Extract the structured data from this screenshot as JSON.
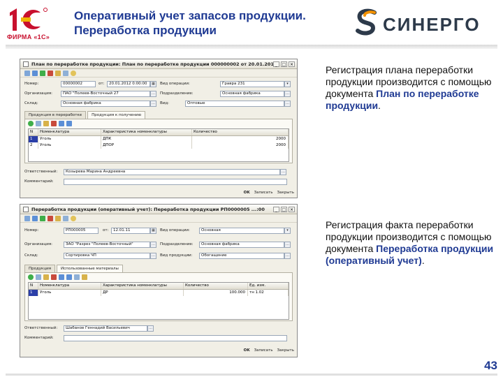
{
  "header": {
    "firm_label": "ФИРМА «1С»",
    "title_line1": "Оперативный учет запасов продукции.",
    "title_line2": "Переработка продукции",
    "partner_name": "СИНЕРГО"
  },
  "window1": {
    "title": "План по переработке продукции: План по переработке продукции 000000002 от 20.01.2012 ...:52",
    "fields": {
      "number_label": "Номер:",
      "number_value": "00000002",
      "date_label": "от:",
      "date_value": "20.01.2012 0:00:00",
      "org_label": "Организация:",
      "org_value": "ПАО \"Полеев-Восточный 27",
      "warehouse_label": "Склад:",
      "warehouse_value": "Основная фабрика",
      "operation_label": "Вид операции:",
      "operation_value": "Гравра 231",
      "unit_label": "Подразделение:",
      "unit_value": "Основная фабрика",
      "type_label": "Вид:",
      "type_value": "Оптовые"
    },
    "tabs": [
      "Продукция в переработке",
      "Продукция к получению"
    ],
    "active_tab": 1,
    "grid_headers": [
      "N",
      "Номенклатура",
      "Характеристика номенклатуры",
      "Количество"
    ],
    "grid_rows": [
      [
        "1",
        "Уголь",
        "ДПК",
        "2000"
      ],
      [
        "2",
        "Уголь",
        "ДПОР",
        "2000"
      ]
    ],
    "responsible_label": "Ответственный:",
    "responsible_value": "Козырева Марина Андреевна",
    "comment_label": "Комментарий:",
    "comment_value": "",
    "footer": {
      "ok": "OK",
      "save": "Записать",
      "close": "Закрыть"
    }
  },
  "window2": {
    "title": "Переработка продукции (оперативный учет): Переработка продукции РП0000005 ...:00",
    "fields": {
      "number_label": "Номер:",
      "number_value": "РП000005",
      "date_label": "от:",
      "date_value": "12.01.11",
      "org_label": "Организация:",
      "org_value": "ЗАО \"Разрез \"Полеев-Восточный\"",
      "warehouse_label": "Склад:",
      "warehouse_value": "Сортировка ЧП",
      "operation_label": "Вид операции:",
      "operation_value": "Основная",
      "unit_label": "Подразделение:",
      "unit_value": "Основная фабрика",
      "type_label": "Вид продукции:",
      "type_value": "Обогащение"
    },
    "tabs": [
      "Продукция",
      "Использованные материалы"
    ],
    "active_tab": 1,
    "grid_headers": [
      "N",
      "Номенклатура",
      "Характеристика номенклатуры",
      "Количество",
      "Ед. изм."
    ],
    "grid_rows": [
      [
        "1",
        "Уголь",
        "ДР",
        "100.000",
        "тн 1.02"
      ]
    ],
    "responsible_label": "Ответственный:",
    "responsible_value": "Шабанов Геннадий Васильевич",
    "comment_label": "Комментарий:",
    "comment_value": "",
    "footer": {
      "ok": "OK",
      "save": "Записать",
      "close": "Закрыть"
    }
  },
  "descriptions": {
    "plan_text": "Регистрация плана переработки продукции производится с помощью документа",
    "plan_doc": "План по переработке продукции",
    "plan_tail": ".",
    "fact_text": "Регистрация факта переработки продукции производится с помощью документа",
    "fact_doc": "Переработка продукции (оперативный учет)",
    "fact_tail": "."
  },
  "page_number": "43",
  "colors": {
    "title_blue": "#1f3a93",
    "brand_red": "#c8102e",
    "sinergo_orange": "#f39200",
    "window_bg": "#f1efe6",
    "selection": "#2b3fa8"
  }
}
